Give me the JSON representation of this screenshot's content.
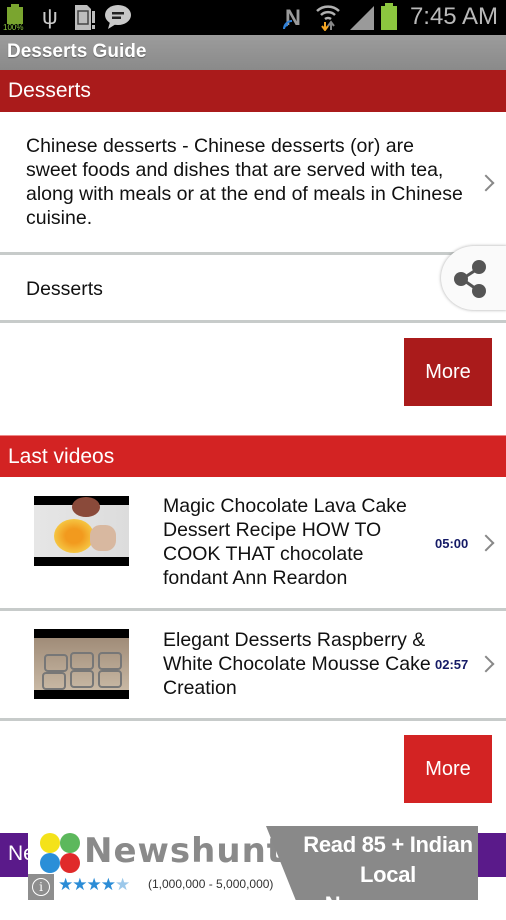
{
  "status_bar": {
    "battery_label": "100%",
    "time": "7:45 AM",
    "icons": [
      "battery-full-icon",
      "usb-icon",
      "sd-card-icon",
      "message-icon",
      "nfc-icon",
      "wifi-icon",
      "signal-icon",
      "battery-charging-icon"
    ],
    "colors": {
      "battery": "#8cc63f",
      "wifi_arrow": "#f5a623"
    }
  },
  "action_bar": {
    "title": "Desserts Guide"
  },
  "desserts_section": {
    "header": "Desserts",
    "header_color": "#aa1b1b",
    "items": [
      {
        "text": "Chinese desserts - Chinese desserts (or) are sweet foods and dishes that are served with tea, along with meals or at the end of meals in Chinese cuisine.",
        "icon": "chevron-right-icon"
      },
      {
        "text": "Desserts",
        "icon": "share-icon"
      }
    ],
    "more_label": "More"
  },
  "videos_section": {
    "header": "Last videos",
    "header_color": "#d32323",
    "items": [
      {
        "title": "Magic Chocolate Lava Cake Dessert Recipe HOW TO COOK THAT chocolate fondant Ann Reardon",
        "duration": "05:00",
        "thumbnail": "video-thumbnail-lava-cake"
      },
      {
        "title": "Elegant Desserts Raspberry & White Chocolate Mousse Cake Creation",
        "duration": "02:57",
        "thumbnail": "video-thumbnail-mousse-cake"
      }
    ],
    "more_label": "More"
  },
  "news_section": {
    "header_partial": "Ne",
    "header_color": "#5a1a8a"
  },
  "ad": {
    "brand": "Newshunt",
    "rating": 4.5,
    "rating_max": 5,
    "installs": "(1,000,000 - 5,000,000)",
    "tagline_line1": "Read 85 + Indian",
    "tagline_line2": "Local Newspapers",
    "info_glyph": "i"
  }
}
